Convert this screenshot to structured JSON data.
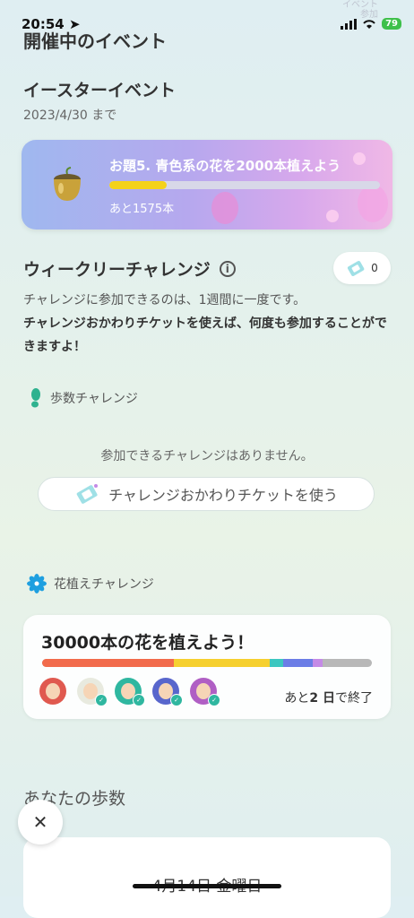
{
  "status": {
    "time": "20:54",
    "battery": "79",
    "ghost_lines": [
      "イベント",
      "参加"
    ]
  },
  "page_title": "開催中のイベント",
  "event": {
    "title": "イースターイベント",
    "until": "2023/4/30 まで",
    "task": "お題5. 青色系の花を2000本植えよう",
    "remaining": "あと1575本",
    "progress": 0.2125,
    "bar_color": "#f4d21a"
  },
  "weekly": {
    "title": "ウィークリーチャレンジ",
    "info_icon": "info-icon",
    "ticket_count": "0",
    "desc_normal": "チャレンジに参加できるのは、1週間に一度です。",
    "desc_bold": "チャレンジおかわりチケットを使えば、何度も参加することができますよ！"
  },
  "steps_challenge": {
    "label": "歩数チャレンジ",
    "icon": "footprint-icon",
    "empty_text": "参加できるチャレンジはありません。",
    "button_label": "チャレンジおかわりチケットを使う"
  },
  "flower_challenge": {
    "label": "花植えチャレンジ",
    "icon": "flower-icon",
    "goal": "30000本の花を植えよう！",
    "segments": [
      {
        "color": "#f26b4c",
        "fraction": 0.4
      },
      {
        "color": "#f6d02f",
        "fraction": 0.29
      },
      {
        "color": "#3cc7c0",
        "fraction": 0.04
      },
      {
        "color": "#6b7de6",
        "fraction": 0.09
      },
      {
        "color": "#c48ae6",
        "fraction": 0.03
      }
    ],
    "avatars": [
      {
        "bg": "#e0594f",
        "verified": false
      },
      {
        "bg": "#e8eadf",
        "verified": true
      },
      {
        "bg": "#2fb7a0",
        "verified": true
      },
      {
        "bg": "#5866cc",
        "verified": true
      },
      {
        "bg": "#b05fc4",
        "verified": true
      }
    ],
    "ends_prefix": "あと",
    "ends_days": "2 日",
    "ends_suffix": "で終了"
  },
  "your_steps": {
    "title": "あなたの歩数",
    "date": "4月14日 金曜日"
  }
}
